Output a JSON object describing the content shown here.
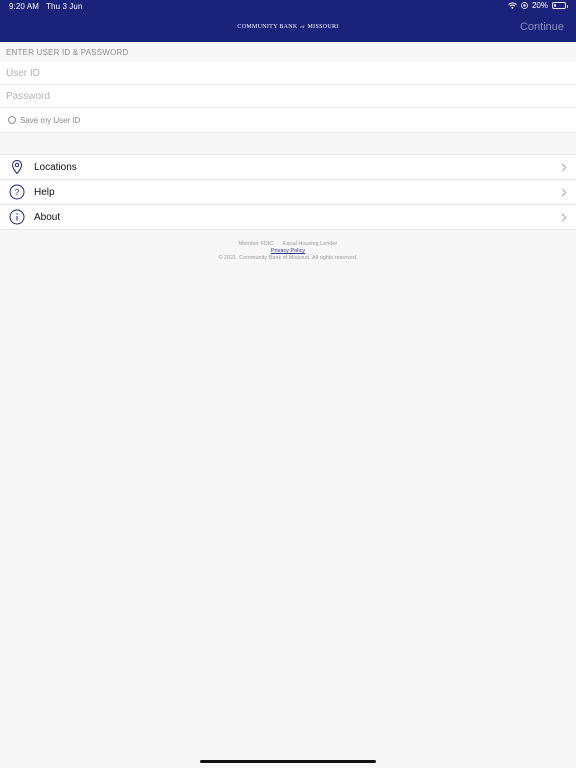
{
  "status_bar": {
    "time": "9:20 AM",
    "date": "Thu 3 Jun",
    "battery": "20%",
    "battery_level": 0.2,
    "icons": [
      "wifi-icon",
      "location-icon",
      "battery-icon"
    ]
  },
  "header": {
    "brand_part1": "COMMUNITY BANK",
    "brand_of": "of",
    "brand_part2": "MISSOURI",
    "continue_label": "Continue",
    "background_color": "#1a2379"
  },
  "login": {
    "section_label": "ENTER USER ID & PASSWORD",
    "user_id_placeholder": "User ID",
    "user_id_value": "",
    "password_placeholder": "Password",
    "password_value": "",
    "save_user_id_label": "Save my User ID",
    "save_user_id_checked": false
  },
  "menu": {
    "items": [
      {
        "label": "Locations",
        "icon": "map-pin-icon"
      },
      {
        "label": "Help",
        "icon": "question-circle-icon"
      },
      {
        "label": "About",
        "icon": "info-circle-icon"
      }
    ]
  },
  "footer": {
    "member_fdic": "Member FDIC",
    "equal_housing": "Equal Housing Lender",
    "privacy_policy": "Privacy Policy",
    "copyright": "© 2021. Community Bank of Missouri. All rights reserved."
  }
}
